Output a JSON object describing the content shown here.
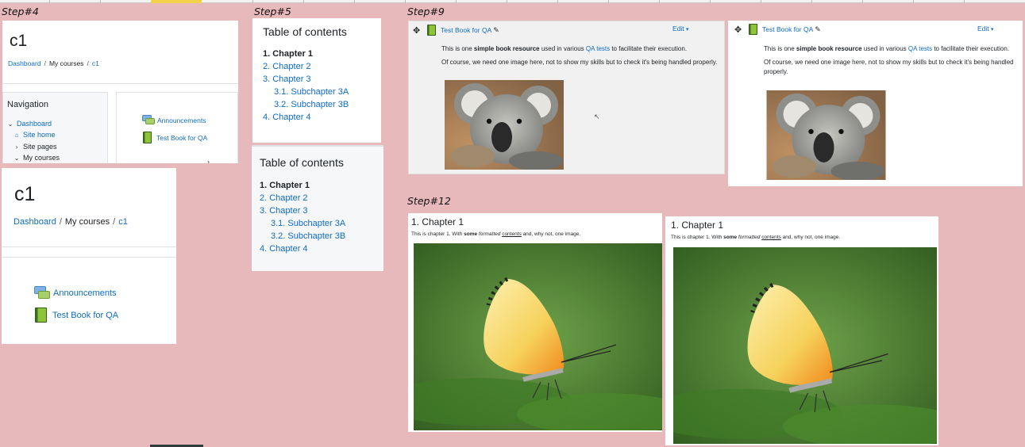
{
  "steps": {
    "step4": "Step#4",
    "step5": "Step#5",
    "step9": "Step#9",
    "step12": "Step#12"
  },
  "course": {
    "title": "c1",
    "breadcrumb": [
      "Dashboard",
      "My courses",
      "c1"
    ]
  },
  "navigation": {
    "title": "Navigation",
    "items": [
      "Dashboard",
      "Site home",
      "Site pages",
      "My courses"
    ]
  },
  "activities": [
    "Announcements",
    "Test Book for QA"
  ],
  "toc": {
    "title": "Table of contents",
    "items": [
      "1. Chapter 1",
      "2. Chapter 2",
      "3. Chapter 3",
      "3.1. Subchapter 3A",
      "3.2. Subchapter 3B",
      "4. Chapter 4"
    ]
  },
  "book": {
    "name": "Test Book for QA",
    "edit": "Edit",
    "intro": {
      "p1_pre": "This is one ",
      "p1_bold": "simple book resource",
      "p1_mid": " used in various ",
      "p1_link": "QA tests",
      "p1_post": " to facilitate their execution.",
      "p2": "Of course, we need one image here, not to show my skills but to check it's being handled properly."
    }
  },
  "chapter": {
    "title": "1. Chapter 1",
    "t_pre": "This is chapter 1. With ",
    "t_bold": "some",
    "t_sp1": " ",
    "t_italic": "formatted",
    "t_sp2": " ",
    "t_under": "contents",
    "t_post": " and, why not, one image."
  },
  "icons": {
    "move": "move-icon",
    "pencil": "pencil-icon",
    "caret": "caret-down-icon",
    "forum": "forum-icon",
    "book": "book-icon",
    "home": "home-icon"
  },
  "colors": {
    "background": "#e8b9bb",
    "link": "#0f6cbf",
    "highlight": "#f4d24a"
  }
}
